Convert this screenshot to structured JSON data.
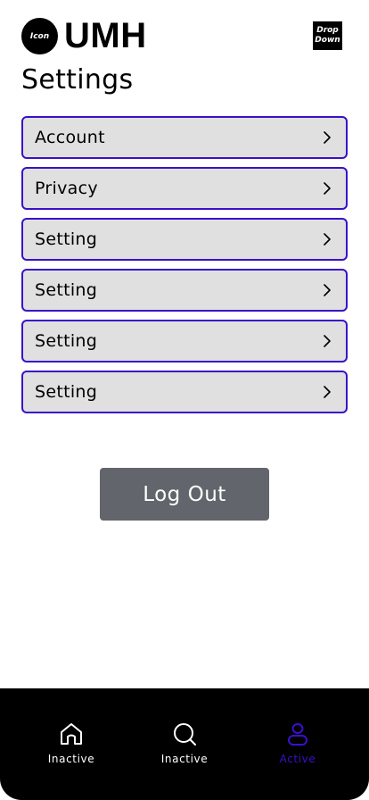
{
  "header": {
    "logo_icon_text": "Icon",
    "brand": "UMH",
    "dropdown_line1": "Drop",
    "dropdown_line2": "Down"
  },
  "page_title": "Settings",
  "settings": [
    {
      "label": "Account"
    },
    {
      "label": "Privacy"
    },
    {
      "label": "Setting"
    },
    {
      "label": "Setting"
    },
    {
      "label": "Setting"
    },
    {
      "label": "Setting"
    }
  ],
  "logout_label": "Log Out",
  "nav": [
    {
      "label": "Inactive",
      "icon": "home-icon",
      "state": "inactive"
    },
    {
      "label": "Inactive",
      "icon": "search-icon",
      "state": "inactive"
    },
    {
      "label": "Active",
      "icon": "user-icon",
      "state": "active"
    }
  ],
  "colors": {
    "accent": "#3a10c9",
    "item_bg": "#e0e0e0",
    "logout_bg": "#63656c",
    "nav_bg": "#000000",
    "nav_inactive": "#ffffff",
    "nav_active": "#3a10c9"
  }
}
